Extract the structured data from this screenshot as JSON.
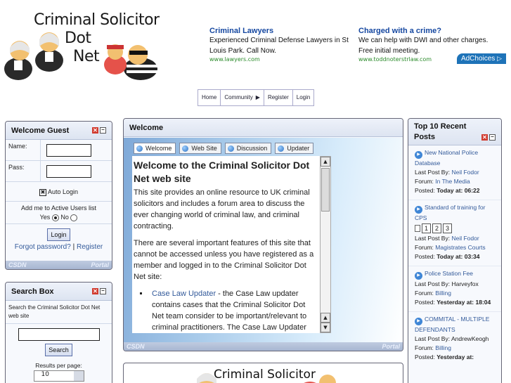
{
  "logo": {
    "line1": "Criminal Solicitor",
    "line2": "Dot",
    "line3": "Net"
  },
  "ad": {
    "items": [
      {
        "title": "Criminal Lawyers",
        "desc": "Experienced Criminal Defense Lawyers in St Louis Park. Call Now.",
        "url": "www.lawyers.com"
      },
      {
        "title": "Charged with a crime?",
        "desc": "We can help with DWI and other charges. Free initial meeting.",
        "url": "www.toddnoterstrlaw.com"
      }
    ],
    "choices_label": "AdChoices"
  },
  "nav": {
    "items": [
      "Home",
      "Community",
      "Register",
      "Login"
    ]
  },
  "guest": {
    "title": "Welcome Guest",
    "name_label": "Name:",
    "pass_label": "Pass:",
    "auto_login": "Auto Login",
    "active_users": "Add me to Active Users list",
    "yes": "Yes",
    "no": "No",
    "login_button": "Login",
    "forgot": "Forgot password?",
    "separator": "|",
    "register": "Register",
    "foot_left": "CSDN",
    "foot_right": "Portal"
  },
  "search": {
    "title": "Search Box",
    "text": "Search the Criminal Solicitor Dot Net web site",
    "button": "Search",
    "results_label": "Results per page:",
    "results_value": "10"
  },
  "welcome": {
    "title": "Welcome",
    "tabs": [
      "Welcome",
      "Web Site",
      "Discussion",
      "Updater"
    ],
    "heading": "Welcome to the Criminal Solicitor Dot Net web site",
    "p1": "This site provides an online resource to UK criminal solicitors and includes a forum area to discuss the ever changing world of criminal law, and criminal contracting.",
    "p2": "There are several important features of this site that cannot be accessed unless you have registered as a member and logged in to the Criminal Solicitor Dot Net site:",
    "li1_link": "Case Law Updater",
    "li1_text": " - the Case Law updater contains cases that the Criminal Solicitor Dot Net team consider to be important/relevant to criminal practitioners. The Case Law Updater",
    "foot_left": "CSDN",
    "foot_right": "Portal"
  },
  "bottom_logo": {
    "text": "Criminal Solicitor"
  },
  "top10": {
    "title": "Top 10 Recent Posts",
    "last_post_label": "Last Post By:",
    "forum_label": "Forum:",
    "posted_label": "Posted:",
    "posts": [
      {
        "title": "New National Police Database",
        "author": "Neil Fodor",
        "forum": "In The Media",
        "day": "Today",
        "time": "at: 06:22"
      },
      {
        "title": "Standard of training for CPS",
        "pages": [
          "1",
          "2",
          "3"
        ],
        "author": "Neil Fodor",
        "forum": "Magistrates Courts",
        "day": "Today",
        "time": "at: 03:34"
      },
      {
        "title": "Police Station Fee",
        "author": "Harveyfox",
        "forum": "Billing",
        "day": "Yesterday",
        "time": "at: 18:04"
      },
      {
        "title": "COMMITAL - MULTIPLE DEFENDANTS",
        "author": "AndrewKeogh",
        "forum": "Billing",
        "day": "Yesterday",
        "time": "at:"
      }
    ]
  }
}
